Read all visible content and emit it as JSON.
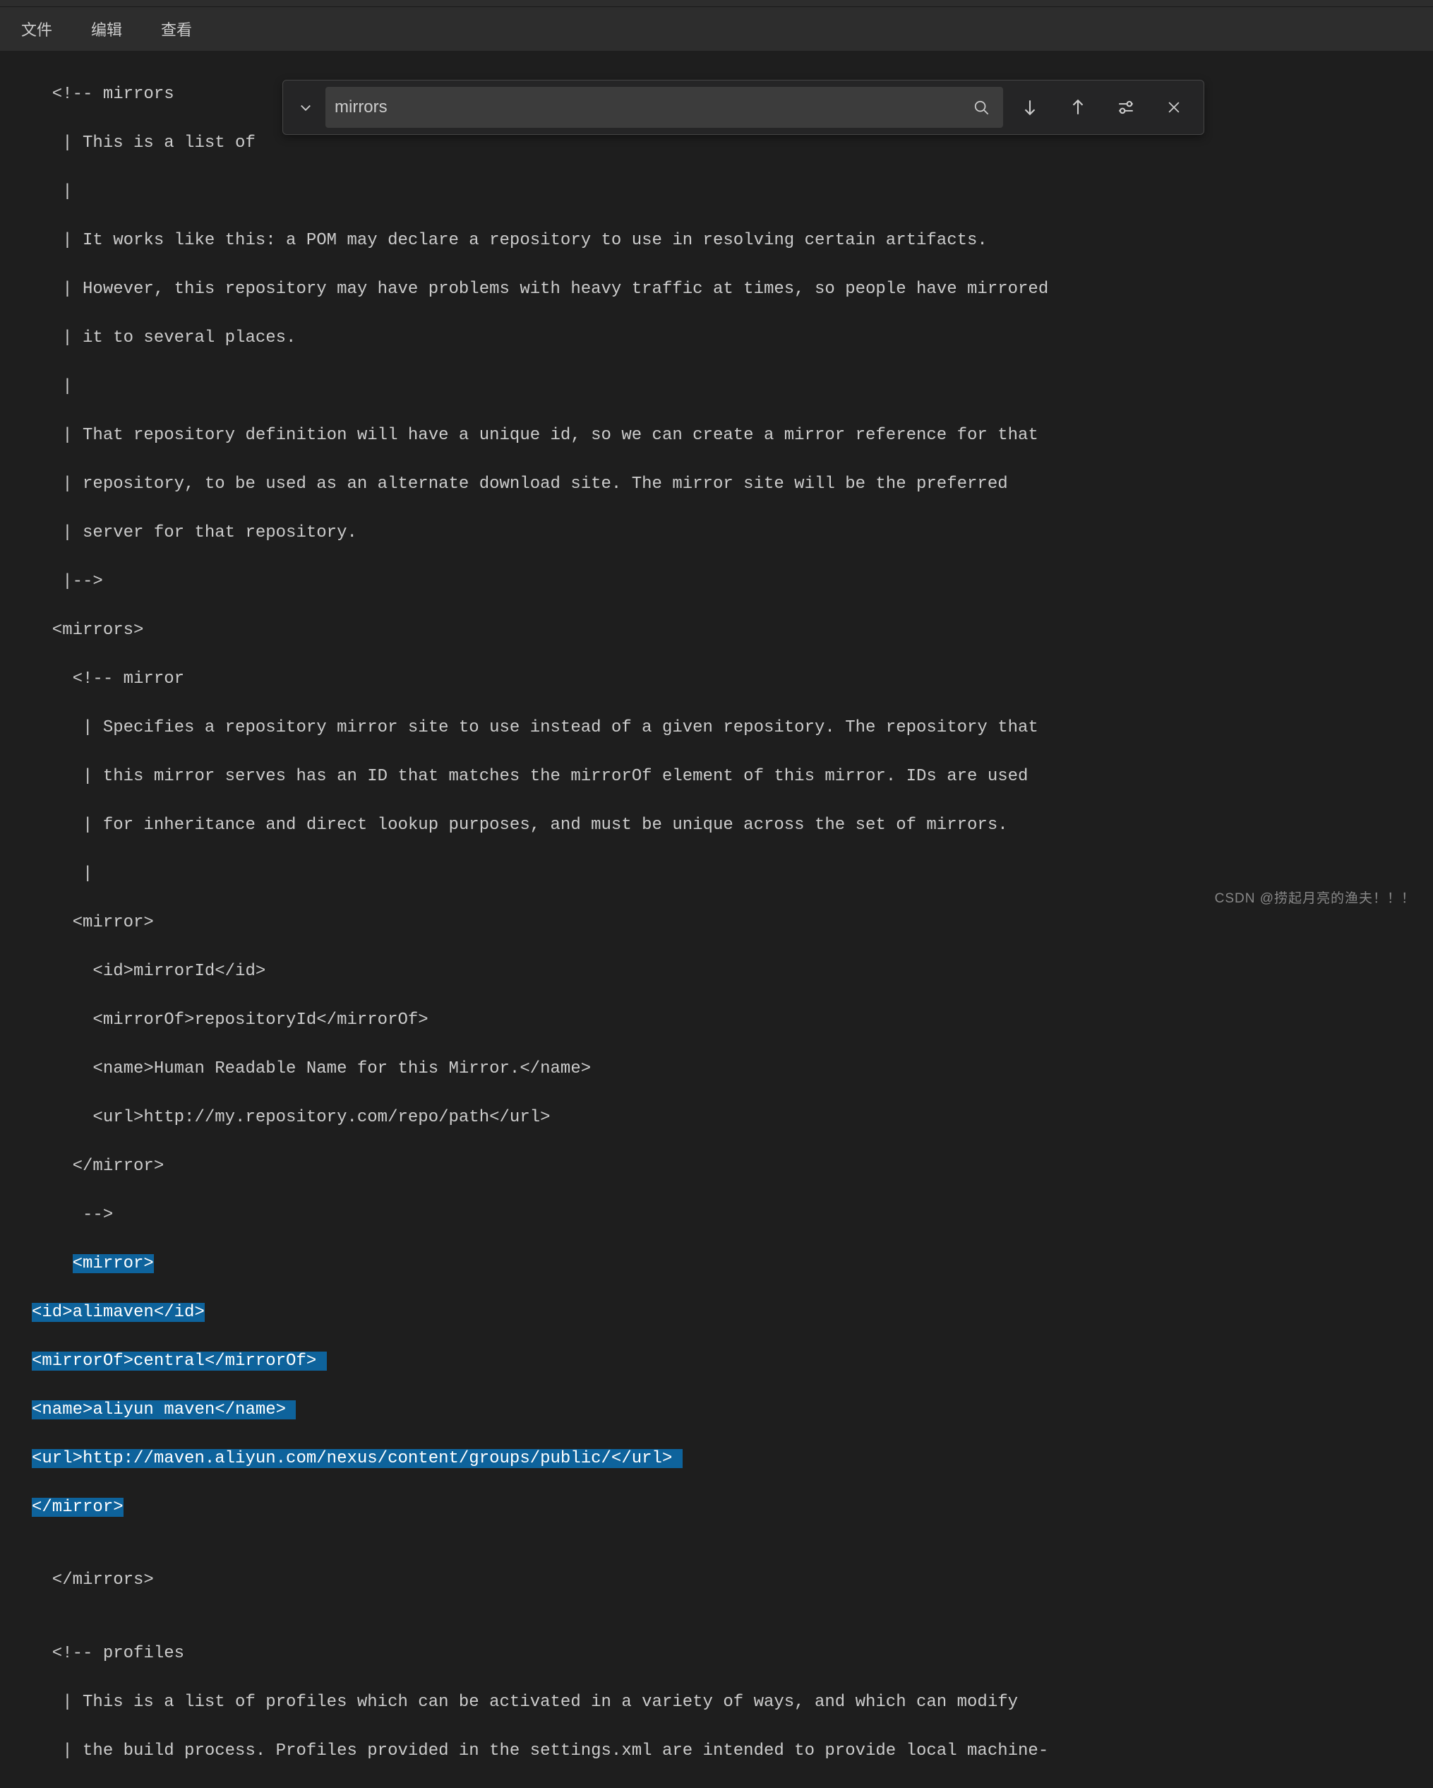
{
  "menubar": {
    "file": "文件",
    "edit": "编辑",
    "view": "查看"
  },
  "search": {
    "query": "mirrors"
  },
  "code": {
    "l1": "  <!-- mirrors",
    "l2": "   | This is a list of",
    "l3": "   |",
    "l4": "   | It works like this: a POM may declare a repository to use in resolving certain artifacts.",
    "l5": "   | However, this repository may have problems with heavy traffic at times, so people have mirrored",
    "l6": "   | it to several places.",
    "l7": "   |",
    "l8": "   | That repository definition will have a unique id, so we can create a mirror reference for that",
    "l9": "   | repository, to be used as an alternate download site. The mirror site will be the preferred",
    "l10": "   | server for that repository.",
    "l11": "   |-->",
    "l12": "  <mirrors>",
    "l13": "    <!-- mirror",
    "l14": "     | Specifies a repository mirror site to use instead of a given repository. The repository that",
    "l15": "     | this mirror serves has an ID that matches the mirrorOf element of this mirror. IDs are used",
    "l16": "     | for inheritance and direct lookup purposes, and must be unique across the set of mirrors.",
    "l17": "     |",
    "l18": "    <mirror>",
    "l19": "      <id>mirrorId</id>",
    "l20": "      <mirrorOf>repositoryId</mirrorOf>",
    "l21": "      <name>Human Readable Name for this Mirror.</name>",
    "l22": "      <url>http://my.repository.com/repo/path</url>",
    "l23": "    </mirror>",
    "l24": "     -->",
    "l25_prefix": "    ",
    "sel_l25": "<mirror>",
    "sel_l26": "<id>alimaven</id>",
    "sel_l27": "<mirrorOf>central</mirrorOf> ",
    "sel_l28": "<name>aliyun maven</name> ",
    "sel_l29": "<url>http://maven.aliyun.com/nexus/content/groups/public/</url> ",
    "sel_l30": "</mirror>",
    "l31": "",
    "l32": "  </mirrors>",
    "l33": "",
    "l34": "  <!-- profiles",
    "l35": "   | This is a list of profiles which can be activated in a variety of ways, and which can modify",
    "l36": "   | the build process. Profiles provided in the settings.xml are intended to provide local machine-"
  },
  "watermark": "CSDN @捞起月亮的渔夫！！！"
}
